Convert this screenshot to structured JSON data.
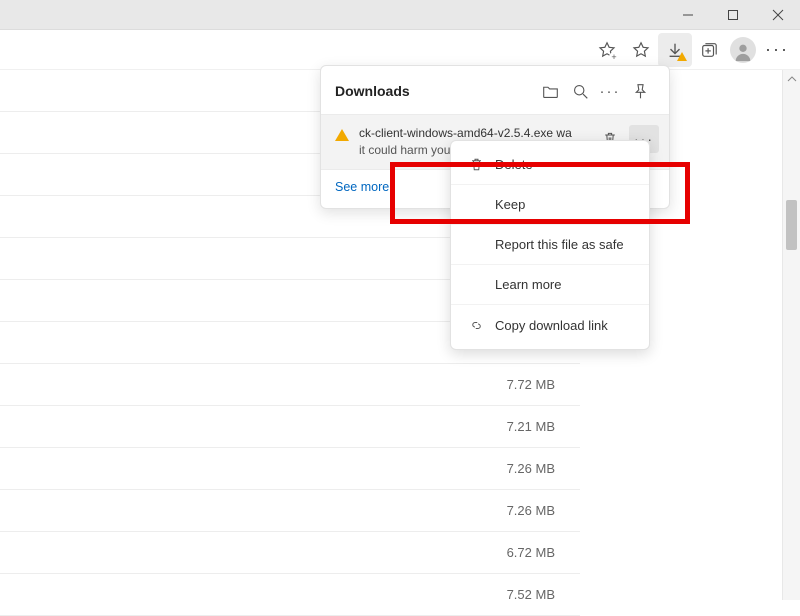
{
  "window": {
    "title": ""
  },
  "toolbar": {
    "icons": {
      "star_add": "star-add-icon",
      "favorites": "favorites-icon",
      "downloads": "downloads-icon",
      "collections": "collections-icon",
      "profile": "profile-icon",
      "more": "more-icon"
    }
  },
  "content_rows": [
    {
      "size": ""
    },
    {
      "size": ""
    },
    {
      "size": ""
    },
    {
      "size": ""
    },
    {
      "size": ""
    },
    {
      "size": ""
    },
    {
      "size": ""
    },
    {
      "size": "7.72 MB"
    },
    {
      "size": "7.21 MB"
    },
    {
      "size": "7.26 MB"
    },
    {
      "size": "7.26 MB"
    },
    {
      "size": "6.72 MB"
    },
    {
      "size": "7.52 MB"
    }
  ],
  "downloads_panel": {
    "title": "Downloads",
    "warning_item": {
      "filename_fragment": "ck-client-windows-amd64-v2.5.4.exe wa",
      "message_line2": "it could harm your device."
    },
    "see_more": "See more"
  },
  "context_menu": {
    "items": [
      {
        "id": "delete",
        "label": "Delete",
        "icon": "trash-icon"
      },
      {
        "id": "keep",
        "label": "Keep",
        "icon": ""
      },
      {
        "id": "report-safe",
        "label": "Report this file as safe",
        "icon": ""
      },
      {
        "id": "learn-more",
        "label": "Learn more",
        "icon": ""
      },
      {
        "id": "copy-link",
        "label": "Copy download link",
        "icon": "link-icon"
      }
    ]
  },
  "highlight": {
    "target_item_id": "keep"
  }
}
